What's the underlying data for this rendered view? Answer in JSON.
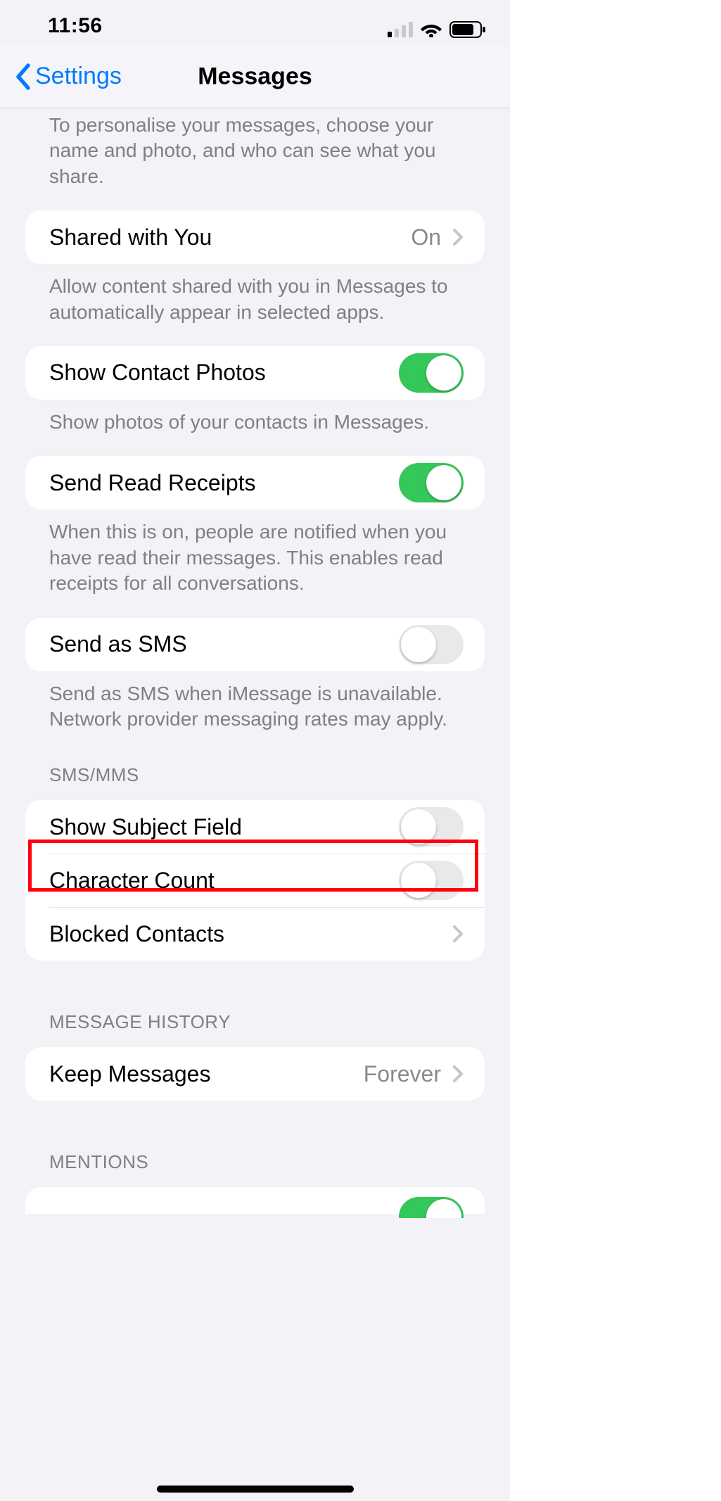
{
  "status": {
    "time": "11:56"
  },
  "nav": {
    "back_label": "Settings",
    "title": "Messages"
  },
  "personalise_footer": "To personalise your messages, choose your name and photo, and who can see what you share.",
  "shared_with_you": {
    "label": "Shared with You",
    "value": "On",
    "footer": "Allow content shared with you in Messages to automatically appear in selected apps."
  },
  "contact_photos": {
    "label": "Show Contact Photos",
    "on": true,
    "footer": "Show photos of your contacts in Messages."
  },
  "read_receipts": {
    "label": "Send Read Receipts",
    "on": true,
    "footer": "When this is on, people are notified when you have read their messages. This enables read receipts for all conversations."
  },
  "send_sms": {
    "label": "Send as SMS",
    "on": false,
    "footer": "Send as SMS when iMessage is unavailable. Network provider messaging rates may apply."
  },
  "sms_mms_header": "SMS/MMS",
  "subject_field": {
    "label": "Show Subject Field",
    "on": false
  },
  "char_count": {
    "label": "Character Count",
    "on": false
  },
  "blocked": {
    "label": "Blocked Contacts"
  },
  "history_header": "MESSAGE HISTORY",
  "keep_messages": {
    "label": "Keep Messages",
    "value": "Forever"
  },
  "mentions_header": "MENTIONS"
}
